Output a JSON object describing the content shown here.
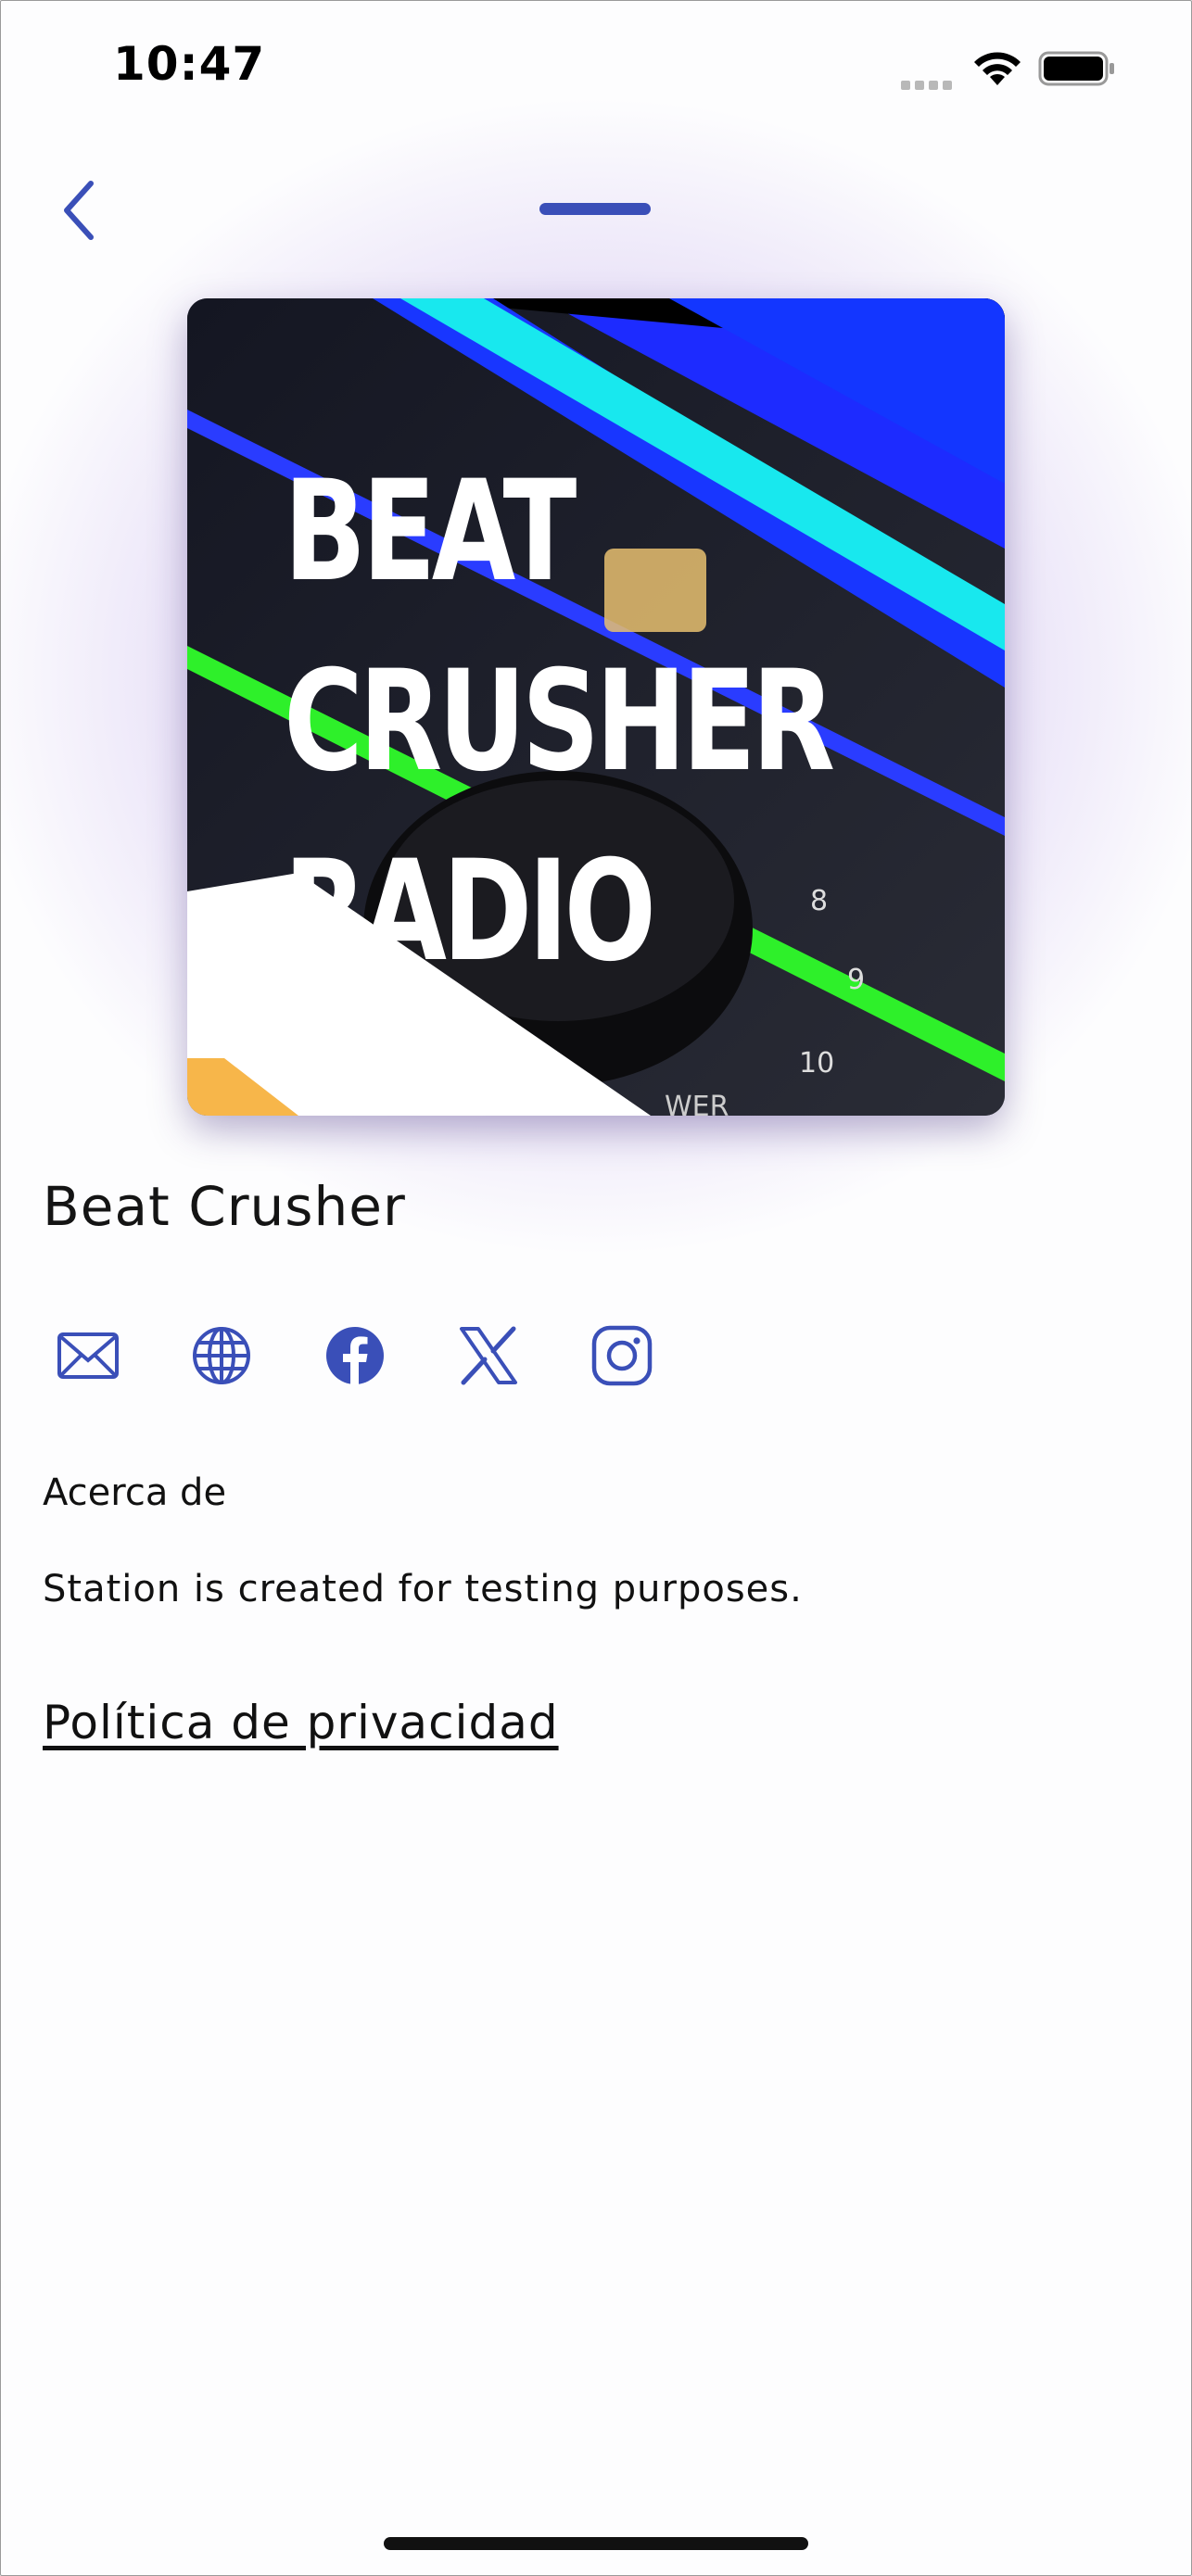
{
  "status_bar": {
    "time": "10:47"
  },
  "nav": {
    "back_icon": "chevron-left-icon",
    "drag_handle": "handle"
  },
  "station": {
    "artwork_text": [
      "BEAT",
      "CRUSHER",
      "RADIO"
    ],
    "artwork_dial_numbers": [
      "8",
      "9",
      "10"
    ],
    "artwork_dial_word": "WER",
    "name": "Beat Crusher"
  },
  "social": {
    "icons": [
      "mail-icon",
      "globe-icon",
      "facebook-icon",
      "x-icon",
      "instagram-icon"
    ]
  },
  "about": {
    "label": "Acerca de",
    "text": "Station is created for testing purposes."
  },
  "privacy_link": "Política de privacidad",
  "colors": {
    "accent": "#3a4fb8",
    "glow": "#9a74d4"
  }
}
